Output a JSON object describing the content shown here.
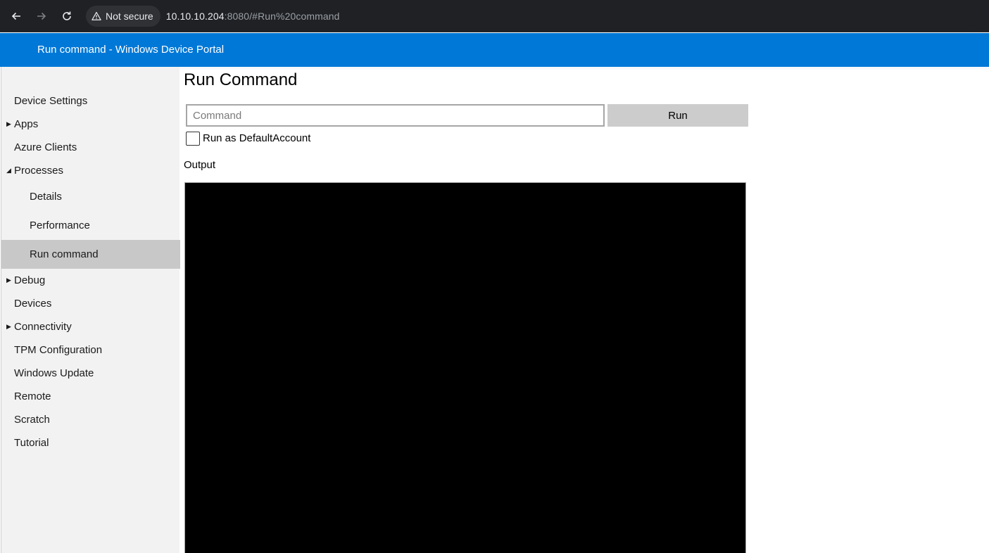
{
  "browser": {
    "security_label": "Not secure",
    "url_host": "10.10.10.204",
    "url_rest": ":8080/#Run%20command",
    "icons": [
      "back-arrow-icon",
      "forward-arrow-icon",
      "reload-icon",
      "warning-triangle-icon"
    ]
  },
  "header": {
    "title": "Run command - Windows Device Portal",
    "color": "#0078d7"
  },
  "sidebar": {
    "items": [
      {
        "label": "Device Settings",
        "expandable": false
      },
      {
        "label": "Apps",
        "expandable": true,
        "expanded": false
      },
      {
        "label": "Azure Clients",
        "expandable": false
      },
      {
        "label": "Processes",
        "expandable": true,
        "expanded": true
      },
      {
        "label": "Details",
        "sub": true
      },
      {
        "label": "Performance",
        "sub": true
      },
      {
        "label": "Run command",
        "sub": true,
        "active": true
      },
      {
        "label": "Debug",
        "expandable": true,
        "expanded": false
      },
      {
        "label": "Devices",
        "expandable": false
      },
      {
        "label": "Connectivity",
        "expandable": true,
        "expanded": false
      },
      {
        "label": "TPM Configuration",
        "expandable": false
      },
      {
        "label": "Windows Update",
        "expandable": false
      },
      {
        "label": "Remote",
        "expandable": false
      },
      {
        "label": "Scratch",
        "expandable": false
      },
      {
        "label": "Tutorial",
        "expandable": false
      }
    ]
  },
  "main": {
    "title": "Run Command",
    "command_placeholder": "Command",
    "command_value": "",
    "run_label": "Run",
    "run_as_label": "Run as DefaultAccount",
    "run_as_checked": false,
    "output_label": "Output",
    "output_text": ""
  }
}
